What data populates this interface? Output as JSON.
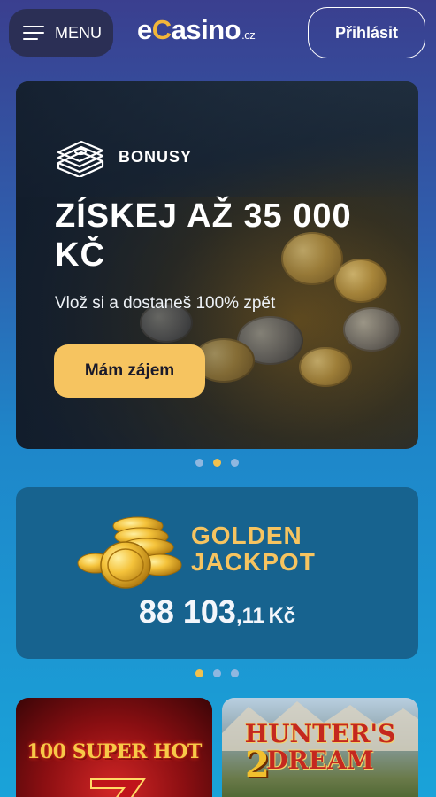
{
  "header": {
    "menu_label": "MENU",
    "logo": {
      "e": "e",
      "c": "C",
      "rest": "asino",
      "tld": ".cz"
    },
    "login_label": "Přihlásit"
  },
  "banner": {
    "category": "BONUSY",
    "title": "ZÍSKEJ AŽ 35 000 KČ",
    "subtitle": "Vlož si a dostaneš 100% zpět",
    "cta_label": "Mám zájem",
    "carousel": {
      "count": 3,
      "active_index": 1
    }
  },
  "jackpot": {
    "title_line1": "GOLDEN",
    "title_line2": "JACKPOT",
    "amount_main": "88 103",
    "amount_decimal": ",11",
    "currency": "Kč",
    "carousel": {
      "count": 3,
      "active_index": 0
    }
  },
  "games": [
    {
      "title": "100 SUPER HOT"
    },
    {
      "title": "HUNTER'S DREAM",
      "number": "2"
    }
  ],
  "colors": {
    "accent_gold": "#f6c460",
    "menu_bg": "#2b2f55",
    "jackpot_bg": "#17638f"
  },
  "icons": {
    "menu": "hamburger-icon",
    "bonus": "money-stack-icon",
    "jackpot": "gold-coins-icon"
  }
}
